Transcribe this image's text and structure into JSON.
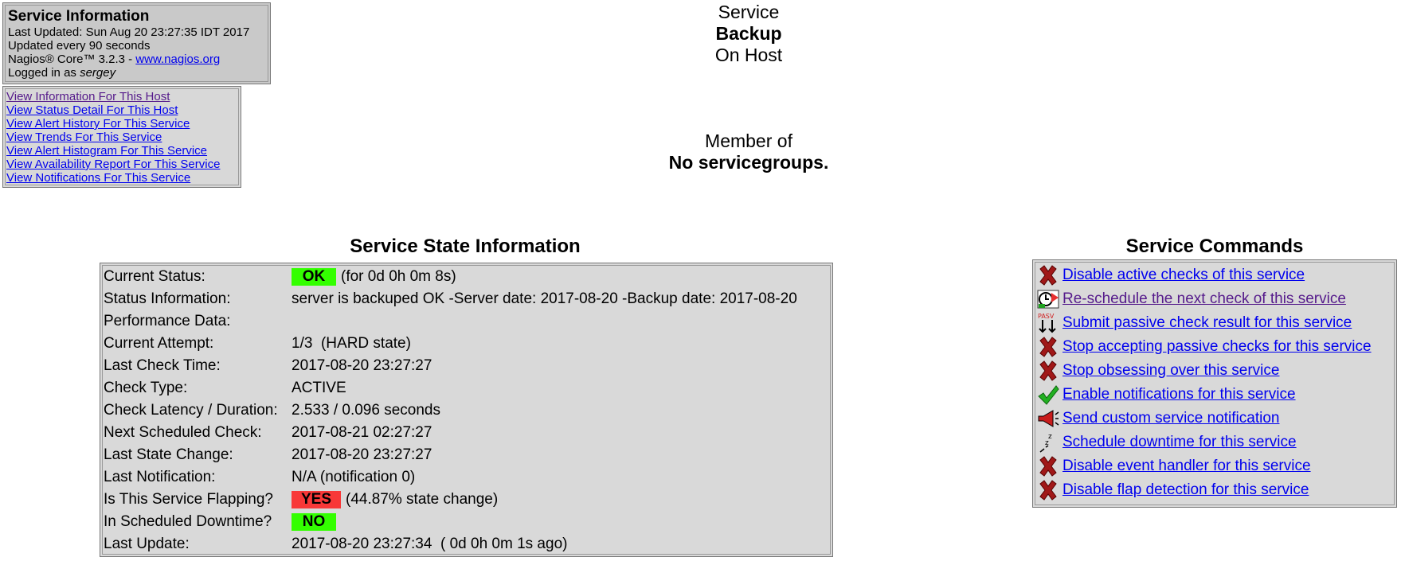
{
  "info": {
    "title": "Service Information",
    "last_updated": "Last Updated: Sun Aug 20 23:27:35 IDT 2017",
    "update_interval": "Updated every 90 seconds",
    "version_prefix": "Nagios® Core™ 3.2.3 - ",
    "version_link": "www.nagios.org",
    "logged_in_prefix": "Logged in as ",
    "user": "sergey"
  },
  "links": [
    "View Information For This Host",
    "View Status Detail For This Host",
    "View Alert History For This Service",
    "View Trends For This Service",
    "View Alert Histogram For This Service",
    "View Availability Report For This Service",
    "View Notifications For This Service"
  ],
  "header": {
    "line1": "Service",
    "service_name": "Backup",
    "line3": "On Host"
  },
  "member": {
    "label": "Member of",
    "groups": "No servicegroups."
  },
  "state": {
    "title": "Service State Information",
    "rows": [
      {
        "label": "Current Status:",
        "badge": "OK",
        "value": "(for 0d 0h 0m 8s)"
      },
      {
        "label": "Status Information:",
        "value": "server is backuped OK -Server date: 2017-08-20 -Backup date: 2017-08-20"
      },
      {
        "label": "Performance Data:",
        "value": ""
      },
      {
        "label": "Current Attempt:",
        "value": "1/3  (HARD state)"
      },
      {
        "label": "Last Check Time:",
        "value": "2017-08-20 23:27:27"
      },
      {
        "label": "Check Type:",
        "value": "ACTIVE"
      },
      {
        "label": "Check Latency / Duration:",
        "value": "2.533 / 0.096 seconds"
      },
      {
        "label": "Next Scheduled Check:",
        "value": "2017-08-21 02:27:27"
      },
      {
        "label": "Last State Change:",
        "value": "2017-08-20 23:27:27"
      },
      {
        "label": "Last Notification:",
        "value": "N/A (notification 0)"
      },
      {
        "label": "Is This Service Flapping?",
        "badge": "YES",
        "value": "(44.87% state change)"
      },
      {
        "label": "In Scheduled Downtime?",
        "badge": "NO",
        "value": ""
      },
      {
        "label": "Last Update:",
        "value": "2017-08-20 23:27:34  ( 0d 0h 0m 1s ago)"
      }
    ]
  },
  "commands": {
    "title": "Service Commands",
    "items": [
      {
        "label": "Disable active checks of this service",
        "icon": "disable-icon"
      },
      {
        "label": "Re-schedule the next check of this service",
        "icon": "reschedule-icon"
      },
      {
        "label": "Submit passive check result for this service",
        "icon": "passive-icon"
      },
      {
        "label": "Stop accepting passive checks for this service",
        "icon": "disable-icon"
      },
      {
        "label": "Stop obsessing over this service",
        "icon": "disable-icon"
      },
      {
        "label": "Enable notifications for this service",
        "icon": "enable-icon"
      },
      {
        "label": "Send custom service notification",
        "icon": "megaphone-icon"
      },
      {
        "label": "Schedule downtime for this service",
        "icon": "downtime-icon"
      },
      {
        "label": "Disable event handler for this service",
        "icon": "disable-icon"
      },
      {
        "label": "Disable flap detection for this service",
        "icon": "disable-icon"
      }
    ]
  },
  "colors": {
    "ok": "#33ff00",
    "critical": "#f83838",
    "link": "#0000ee",
    "visited": "#551a8b"
  }
}
